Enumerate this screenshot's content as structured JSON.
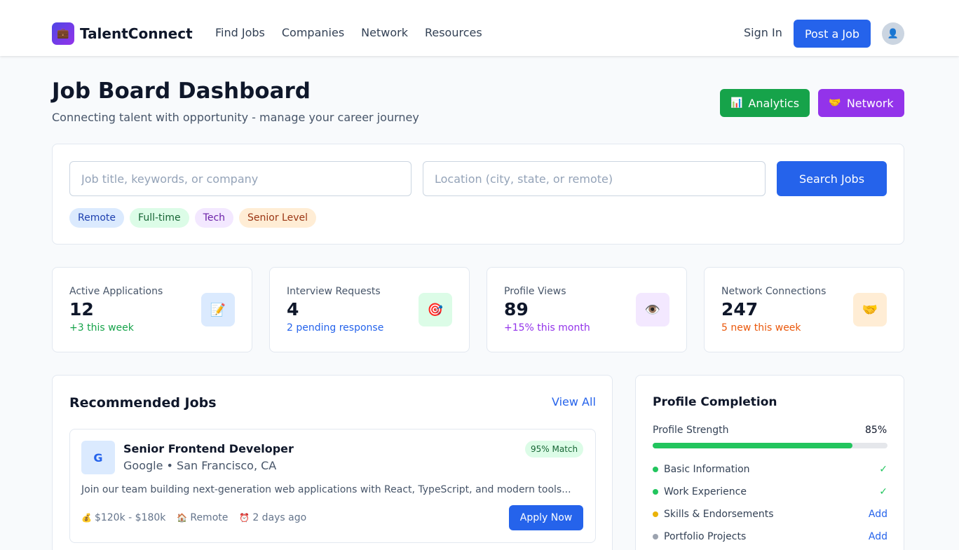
{
  "header": {
    "brand_icon": "briefcase-icon",
    "brand_name": "TalentConnect",
    "nav": [
      "Find Jobs",
      "Companies",
      "Network",
      "Resources"
    ],
    "sign_in": "Sign In",
    "post_job": "Post a Job",
    "avatar_icon": "user-icon"
  },
  "page": {
    "title": "Job Board Dashboard",
    "subtitle": "Connecting talent with opportunity - manage your career journey",
    "analytics_label": "Analytics",
    "analytics_icon": "📊",
    "network_label": "Network",
    "network_icon": "🤝"
  },
  "search": {
    "keyword_placeholder": "Job title, keywords, or company",
    "keyword_value": "",
    "location_placeholder": "Location (city, state, or remote)",
    "location_value": "",
    "button": "Search Jobs",
    "tags": [
      {
        "label": "Remote",
        "bg": "#dbeafe",
        "color": "#1e40af"
      },
      {
        "label": "Full-time",
        "bg": "#dcfce7",
        "color": "#166534"
      },
      {
        "label": "Tech",
        "bg": "#f3e8ff",
        "color": "#6b21a8"
      },
      {
        "label": "Senior Level",
        "bg": "#ffedd5",
        "color": "#9a3412"
      }
    ]
  },
  "stats": [
    {
      "label": "Active Applications",
      "value": "12",
      "delta": "+3 this week",
      "delta_color": "#16a34a",
      "icon": "📝",
      "icon_name": "memo-icon",
      "icon_bg": "#dbeafe"
    },
    {
      "label": "Interview Requests",
      "value": "4",
      "delta": "2 pending response",
      "delta_color": "#2563eb",
      "icon": "🎯",
      "icon_name": "target-icon",
      "icon_bg": "#dcfce7"
    },
    {
      "label": "Profile Views",
      "value": "89",
      "delta": "+15% this month",
      "delta_color": "#9333ea",
      "icon": "👁️",
      "icon_name": "eye-icon",
      "icon_bg": "#f3e8ff"
    },
    {
      "label": "Network Connections",
      "value": "247",
      "delta": "5 new this week",
      "delta_color": "#ea580c",
      "icon": "🤝",
      "icon_name": "handshake-icon",
      "icon_bg": "#ffedd5"
    }
  ],
  "jobs": {
    "title": "Recommended Jobs",
    "view_all": "View All",
    "items": [
      {
        "logo_letter": "G",
        "title": "Senior Frontend Developer",
        "company": "Google • San Francisco, CA",
        "match": "95% Match",
        "description": "Join our team building next-generation web applications with React, TypeScript, and modern tools...",
        "salary": "$120k - $180k",
        "salary_icon": "💰",
        "location_type": "Remote",
        "location_icon": "🏠",
        "posted": "2 days ago",
        "posted_icon": "⏰",
        "apply": "Apply Now"
      }
    ]
  },
  "profile": {
    "title": "Profile Completion",
    "strength_label": "Profile Strength",
    "strength_value": "85%",
    "strength_fraction": 0.85,
    "items": [
      {
        "label": "Basic Information",
        "status": "✓",
        "dot": "#22c55e",
        "action_color": "#22c55e"
      },
      {
        "label": "Work Experience",
        "status": "✓",
        "dot": "#22c55e",
        "action_color": "#22c55e"
      },
      {
        "label": "Skills & Endorsements",
        "status": "Add",
        "dot": "#eab308",
        "action_color": "#2563eb"
      },
      {
        "label": "Portfolio Projects",
        "status": "Add",
        "dot": "#9ca3af",
        "action_color": "#2563eb"
      }
    ]
  }
}
